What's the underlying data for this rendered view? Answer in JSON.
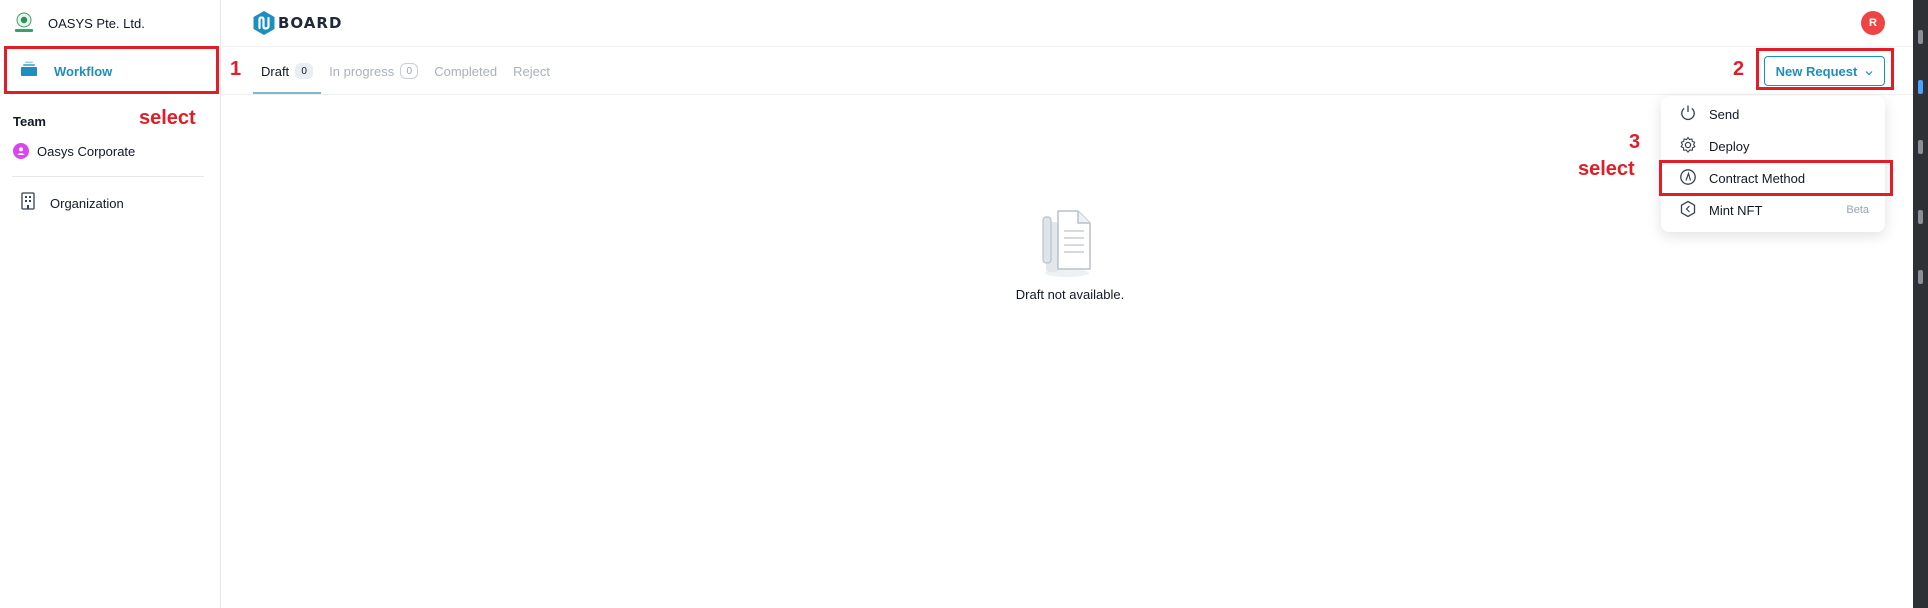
{
  "org": {
    "name": "OASYS Pte. Ltd."
  },
  "sidebar": {
    "workflow_label": "Workflow",
    "team_title": "Team",
    "team_item": "Oasys Corporate",
    "organization_label": "Organization"
  },
  "header": {
    "brand": "BOARD",
    "user_initial": "R"
  },
  "tabs": [
    {
      "label": "Draft",
      "count": "0"
    },
    {
      "label": "In progress",
      "count": "0"
    },
    {
      "label": "Completed"
    },
    {
      "label": "Reject"
    }
  ],
  "new_request": {
    "label": "New Request"
  },
  "menu": {
    "items": [
      {
        "label": "Send"
      },
      {
        "label": "Deploy"
      },
      {
        "label": "Contract Method"
      },
      {
        "label": "Mint NFT",
        "tag": "Beta"
      }
    ]
  },
  "empty_state": {
    "text": "Draft not available."
  },
  "annotations": {
    "step1": "1",
    "step2": "2",
    "step3": "3",
    "select1": "select",
    "select3": "select"
  },
  "colors": {
    "accent": "#1d8fbf",
    "annotation": "#e11d27",
    "avatar": "#ef4444",
    "team_avatar": "#d946ef"
  }
}
